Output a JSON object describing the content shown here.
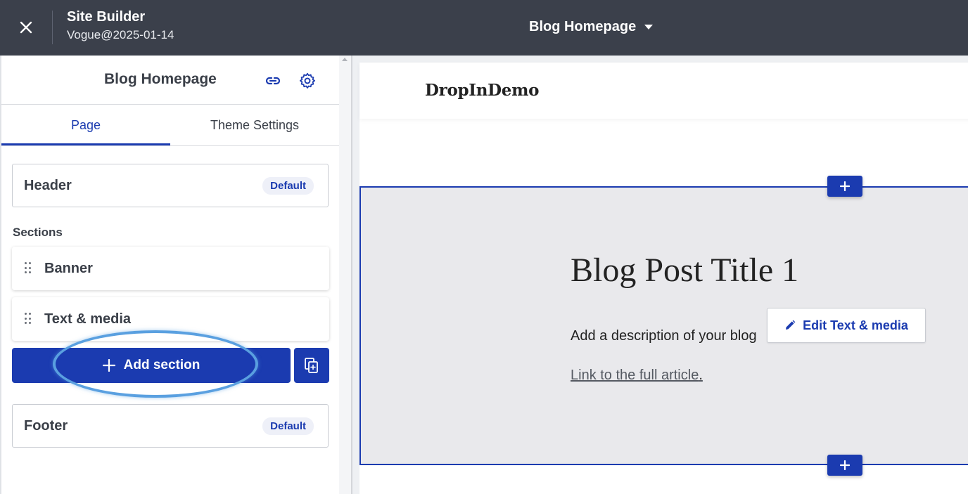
{
  "topbar": {
    "title": "Site Builder",
    "subtitle": "Vogue@2025-01-14",
    "page_selector": "Blog Homepage"
  },
  "sidebar": {
    "title": "Blog Homepage",
    "tabs": [
      {
        "label": "Page",
        "active": true
      },
      {
        "label": "Theme Settings",
        "active": false
      }
    ],
    "header_card": {
      "label": "Header",
      "badge": "Default"
    },
    "sections_label": "Sections",
    "sections": [
      {
        "label": "Banner"
      },
      {
        "label": "Text & media"
      }
    ],
    "add_section_label": "Add section",
    "footer_card": {
      "label": "Footer",
      "badge": "Default"
    }
  },
  "preview": {
    "site_logo": "DropInDemo",
    "post_title": "Blog Post Title 1",
    "post_description": "Add a description of your blog",
    "post_link": "Link to the full article",
    "post_link_suffix": ".",
    "edit_button_label": "Edit Text & media"
  },
  "colors": {
    "topbar_bg": "#3b404b",
    "accent": "#1b3bb0",
    "section_bg": "#e9e9ec",
    "highlight": "#5aa0e0"
  },
  "icons": {
    "close": "close-icon",
    "page_dropdown": "chevron-down-icon",
    "link": "link-icon",
    "settings": "gear-icon",
    "drag": "drag-handle-icon",
    "add": "plus-icon",
    "copy": "copy-section-icon",
    "edit": "pencil-icon"
  }
}
